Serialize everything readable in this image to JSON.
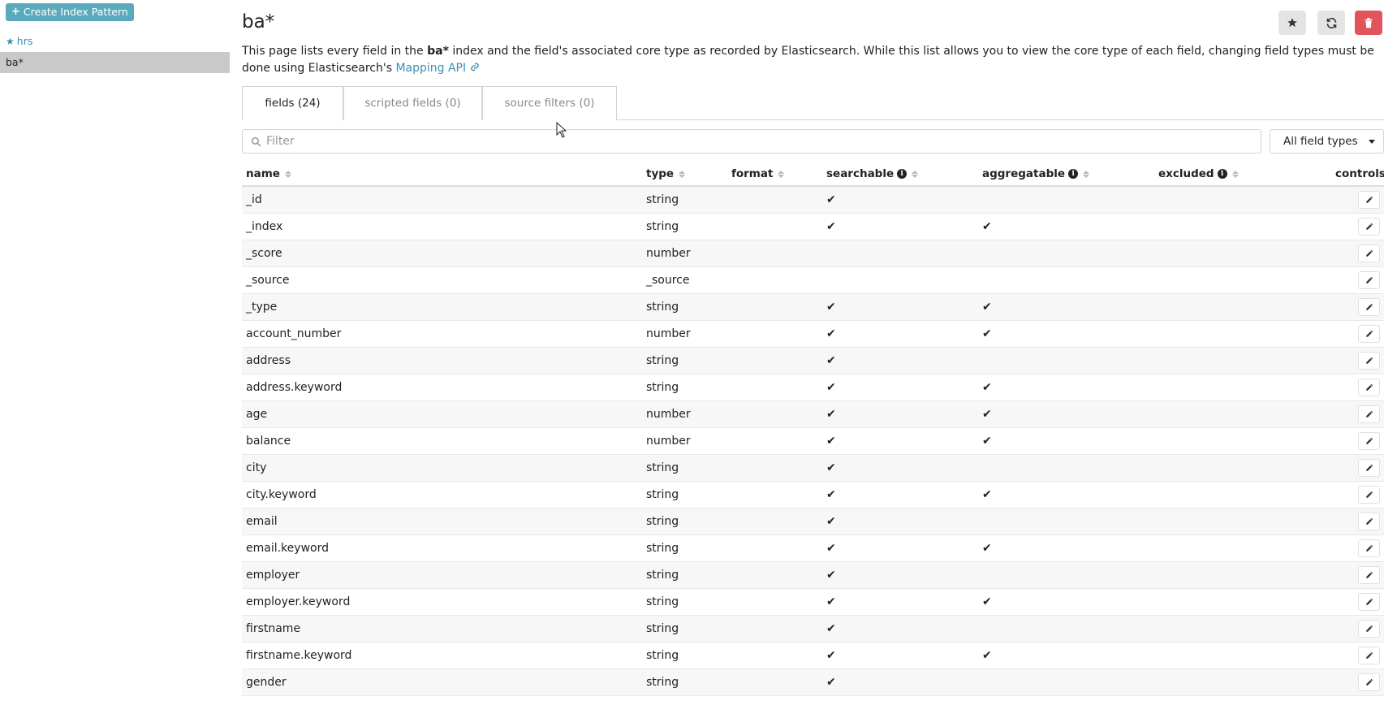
{
  "sidebar": {
    "create_label": "Create Index Pattern",
    "items": [
      {
        "label": "hrs",
        "starred": true
      },
      {
        "label": "ba*",
        "starred": false
      }
    ]
  },
  "header": {
    "title": "ba*",
    "description_prefix": "This page lists every field in the ",
    "description_bold": "ba*",
    "description_middle": " index and the field's associated core type as recorded by Elasticsearch. While this list allows you to view the core type of each field, changing field types must be done using Elasticsearch's ",
    "mapping_link": "Mapping API"
  },
  "tabs": [
    {
      "label": "fields (24)"
    },
    {
      "label": "scripted fields (0)"
    },
    {
      "label": "source filters (0)"
    }
  ],
  "filter": {
    "placeholder": "Filter",
    "value": ""
  },
  "type_select": {
    "selected": "All field types"
  },
  "columns": {
    "name": "name",
    "type": "type",
    "format": "format",
    "searchable": "searchable",
    "aggregatable": "aggregatable",
    "excluded": "excluded",
    "controls": "controls"
  },
  "rows": [
    {
      "name": "_id",
      "type": "string",
      "searchable": true,
      "aggregatable": false
    },
    {
      "name": "_index",
      "type": "string",
      "searchable": true,
      "aggregatable": true
    },
    {
      "name": "_score",
      "type": "number",
      "searchable": false,
      "aggregatable": false
    },
    {
      "name": "_source",
      "type": "_source",
      "searchable": false,
      "aggregatable": false
    },
    {
      "name": "_type",
      "type": "string",
      "searchable": true,
      "aggregatable": true
    },
    {
      "name": "account_number",
      "type": "number",
      "searchable": true,
      "aggregatable": true
    },
    {
      "name": "address",
      "type": "string",
      "searchable": true,
      "aggregatable": false
    },
    {
      "name": "address.keyword",
      "type": "string",
      "searchable": true,
      "aggregatable": true
    },
    {
      "name": "age",
      "type": "number",
      "searchable": true,
      "aggregatable": true
    },
    {
      "name": "balance",
      "type": "number",
      "searchable": true,
      "aggregatable": true
    },
    {
      "name": "city",
      "type": "string",
      "searchable": true,
      "aggregatable": false
    },
    {
      "name": "city.keyword",
      "type": "string",
      "searchable": true,
      "aggregatable": true
    },
    {
      "name": "email",
      "type": "string",
      "searchable": true,
      "aggregatable": false
    },
    {
      "name": "email.keyword",
      "type": "string",
      "searchable": true,
      "aggregatable": true
    },
    {
      "name": "employer",
      "type": "string",
      "searchable": true,
      "aggregatable": false
    },
    {
      "name": "employer.keyword",
      "type": "string",
      "searchable": true,
      "aggregatable": true
    },
    {
      "name": "firstname",
      "type": "string",
      "searchable": true,
      "aggregatable": false
    },
    {
      "name": "firstname.keyword",
      "type": "string",
      "searchable": true,
      "aggregatable": true
    },
    {
      "name": "gender",
      "type": "string",
      "searchable": true,
      "aggregatable": false
    }
  ],
  "colors": {
    "accent": "#3a8fb7",
    "create_button": "#5aaabd",
    "delete_button": "#e2545b",
    "selected_item": "#c9c9c9"
  }
}
